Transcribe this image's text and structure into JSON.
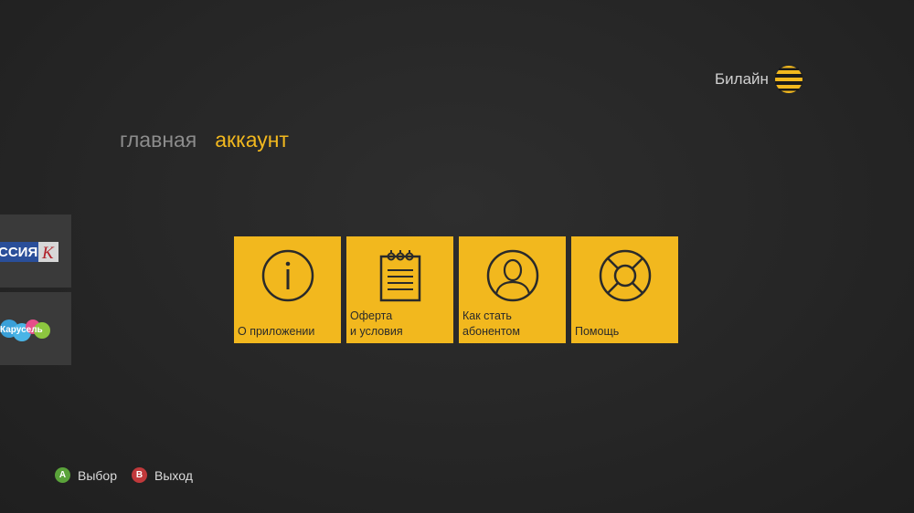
{
  "header": {
    "brand_label": "Билайн",
    "brand_icon": "beeline-logo-icon"
  },
  "nav": {
    "items": [
      {
        "label": "главная",
        "active": false
      },
      {
        "label": "аккаунт",
        "active": true
      }
    ]
  },
  "side_channels": [
    {
      "name": "Россия К",
      "text": "ССИЯ",
      "badge": "К"
    },
    {
      "name": "Карусель",
      "text": "Карусель"
    }
  ],
  "tiles": [
    {
      "label": "О приложении",
      "icon": "info-icon"
    },
    {
      "label": "Оферта\nи условия",
      "icon": "notepad-icon"
    },
    {
      "label": "Как стать\nабонентом",
      "icon": "user-icon"
    },
    {
      "label": "Помощь",
      "icon": "lifebuoy-icon"
    }
  ],
  "hints": {
    "a_key": "A",
    "a_label": "Выбор",
    "b_key": "B",
    "b_label": "Выход"
  },
  "colors": {
    "accent": "#f2b81e",
    "background": "#262626",
    "hint_a": "#5aa33a",
    "hint_b": "#c0393b"
  }
}
